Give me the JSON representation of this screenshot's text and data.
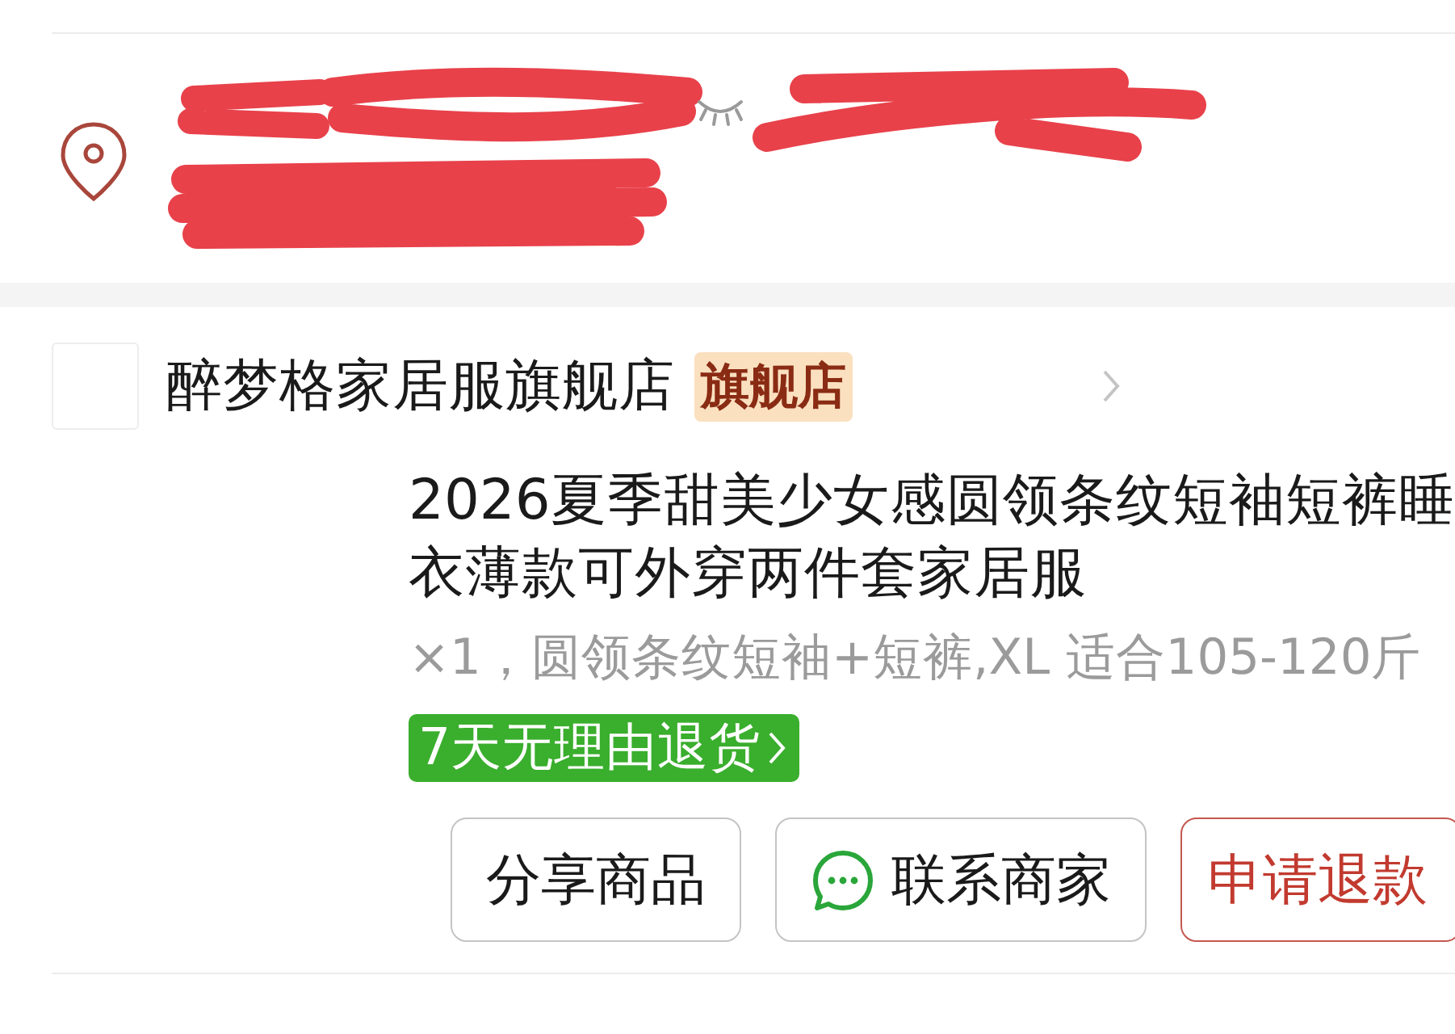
{
  "store": {
    "name": "醉梦格家居服旗舰店",
    "badge": "旗舰店"
  },
  "product": {
    "title": "2026夏季甜美少女感圆领条纹短袖短裤睡衣薄款可外穿两件套家居服",
    "spec": "×1，圆领条纹短袖+短裤,XL 适合105-120斤",
    "return_badge": "7天无理由退货"
  },
  "actions": [
    {
      "label": "分享商品",
      "kind": "plain"
    },
    {
      "label": "联系商家",
      "kind": "chat"
    },
    {
      "label": "申请退款",
      "kind": "danger"
    }
  ]
}
